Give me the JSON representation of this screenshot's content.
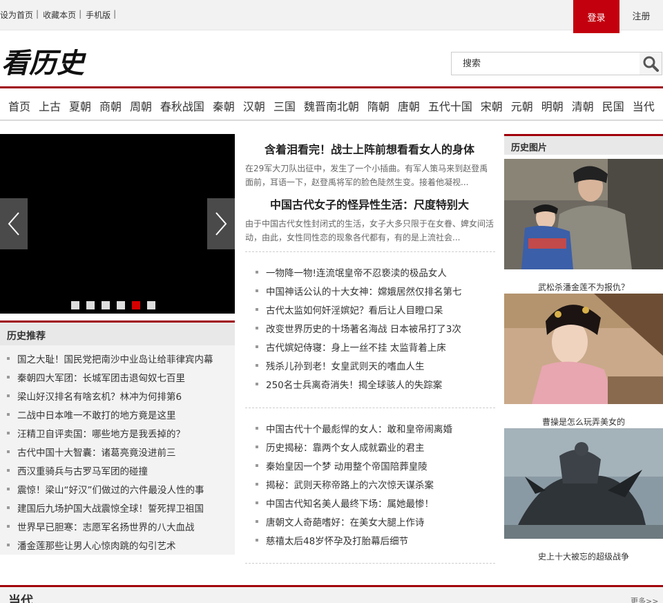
{
  "topbar": {
    "links": [
      "设为首页",
      "收藏本页",
      "手机版"
    ],
    "separator": "|",
    "login": "登录",
    "register": "注册"
  },
  "logo": {
    "text": "看历史"
  },
  "search": {
    "placeholder": "搜索"
  },
  "nav": [
    "首页",
    "上古",
    "夏朝",
    "商朝",
    "周朝",
    "春秋战国",
    "秦朝",
    "汉朝",
    "三国",
    "魏晋南北朝",
    "隋朝",
    "唐朝",
    "五代十国",
    "宋朝",
    "元朝",
    "明朝",
    "清朝",
    "民国",
    "当代"
  ],
  "slider": {
    "dot_count": 6,
    "active_index": 4
  },
  "recommend": {
    "title": "历史推荐",
    "items": [
      "国之大耻！国民党把南沙中业岛让给菲律宾内幕",
      "秦朝四大军团：长城军团击退匈奴七百里",
      "梁山好汉排名有啥玄机？林冲为何排第6",
      "二战中日本唯一不敢打的地方竟是这里",
      "汪精卫自评卖国：哪些地方是我丢掉的？",
      "古代中国十大智囊：诸葛亮竟没进前三",
      "西汉重骑兵与古罗马军团的碰撞",
      "震惊！梁山“好汉”们做过的六件最没人性的事",
      "建国后九场护国大战震惊全球！誓死捍卫祖国",
      "世界早已胆寒：志愿军名扬世界的八大血战",
      "潘金莲那些让男人心惊肉跳的勾引艺术"
    ]
  },
  "featured": [
    {
      "title": "含着泪看完！战士上阵前想看看女人的身体",
      "desc": "在29军大刀队出征中，发生了一个小插曲。有军人策马来到赵登禹面前，耳语一下，赵登禹将军的脸色陡然生变。接着他凝视..."
    },
    {
      "title": "中国古代女子的怪异性生活：尺度特别大",
      "desc": "由于中国古代女性封闭式的生活，女子大多只限于在女眷、婢女间活动，由此，女性同性恋的现象各代都有，有的是上流社会..."
    }
  ],
  "list1": [
    "一物降一物!连流氓皇帝不忍亵渎的极品女人",
    "中国神话公认的十大女神：嫦娥居然仅排名第七",
    "古代太监如何奸淫嫔妃？看后让人目瞪口呆",
    "改变世界历史的十场著名海战 日本被吊打了3次",
    "古代嫔妃侍寝：身上一丝不挂 太监背着上床",
    "残杀儿孙到老！女皇武则天的嗜血人生",
    "250名士兵离奇消失！揭全球骇人的失踪案"
  ],
  "list2": [
    "中国古代十个最彪悍的女人：敢和皇帝闹离婚",
    "历史揭秘：靠两个女人成就霸业的君主",
    "秦始皇因一个梦 动用整个帝国陪葬皇陵",
    "揭秘：武则天称帝路上的六次惊天谋杀案",
    "中国古代知名美人最终下场：属她最惨！",
    "唐朝文人奇葩嗜好：在美女大腿上作诗",
    "慈禧太后48岁怀孕及打胎幕后细节"
  ],
  "pictures": {
    "title": "历史图片",
    "items": [
      {
        "caption": "武松杀潘金莲不为报仇？"
      },
      {
        "caption": "曹操是怎么玩弄美女的"
      },
      {
        "caption": "史上十大被忘的超级战争"
      }
    ]
  },
  "bottom": {
    "title": "当代",
    "more": "更多>>"
  }
}
